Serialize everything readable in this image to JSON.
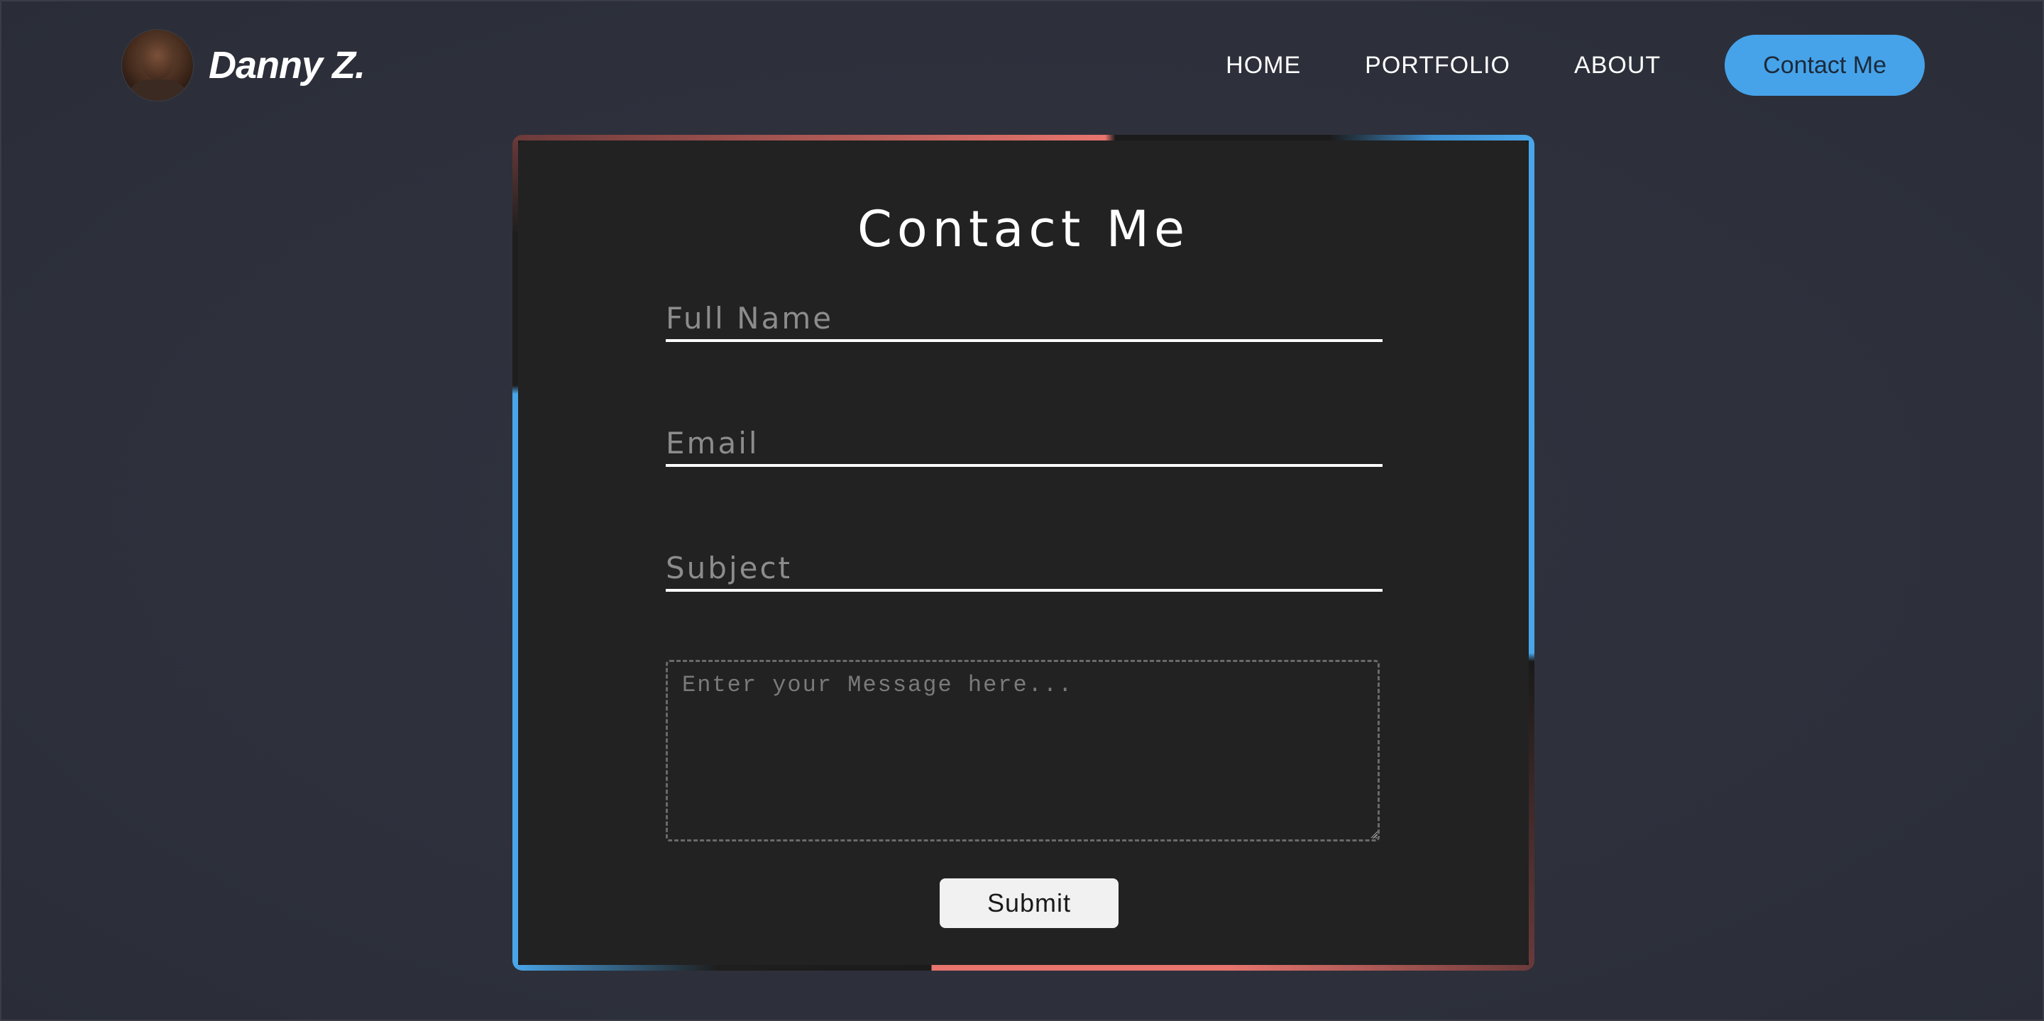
{
  "header": {
    "brand_name": "Danny Z.",
    "nav": {
      "home": "HOME",
      "portfolio": "PORTFOLIO",
      "about": "ABOUT",
      "contact": "Contact Me"
    }
  },
  "form": {
    "title": "Contact Me",
    "full_name_placeholder": "Full Name",
    "email_placeholder": "Email",
    "subject_placeholder": "Subject",
    "message_placeholder": "Enter your Message here...",
    "submit_label": "Submit"
  },
  "colors": {
    "background": "#2e313d",
    "card": "#222222",
    "accent_blue": "#46a3ea",
    "accent_coral": "#e8756e"
  },
  "icons": {
    "avatar": "profile-photo",
    "resize": "resize-grip-icon"
  }
}
